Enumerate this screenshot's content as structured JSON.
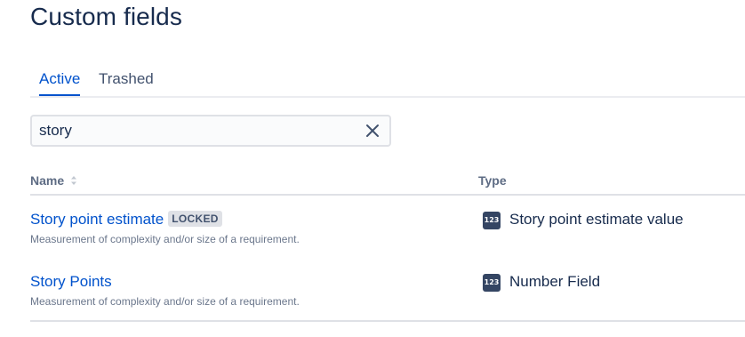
{
  "page": {
    "title": "Custom fields"
  },
  "tabs": [
    {
      "label": "Active",
      "selected": true
    },
    {
      "label": "Trashed",
      "selected": false
    }
  ],
  "search": {
    "value": "story",
    "clear_icon": "close-icon"
  },
  "table": {
    "columns": {
      "name": "Name",
      "type": "Type"
    },
    "rows": [
      {
        "name": "Story point estimate",
        "badge": "LOCKED",
        "description": "Measurement of complexity and/or size of a requirement.",
        "type_icon_text": "123",
        "type": "Story point estimate value"
      },
      {
        "name": "Story Points",
        "badge": "",
        "description": "Measurement of complexity and/or size of a requirement.",
        "type_icon_text": "123",
        "type": "Number Field"
      }
    ]
  },
  "colors": {
    "link": "#0052cc",
    "text": "#172b4d",
    "subtle": "#6b778c",
    "icon_bg": "#344563"
  }
}
